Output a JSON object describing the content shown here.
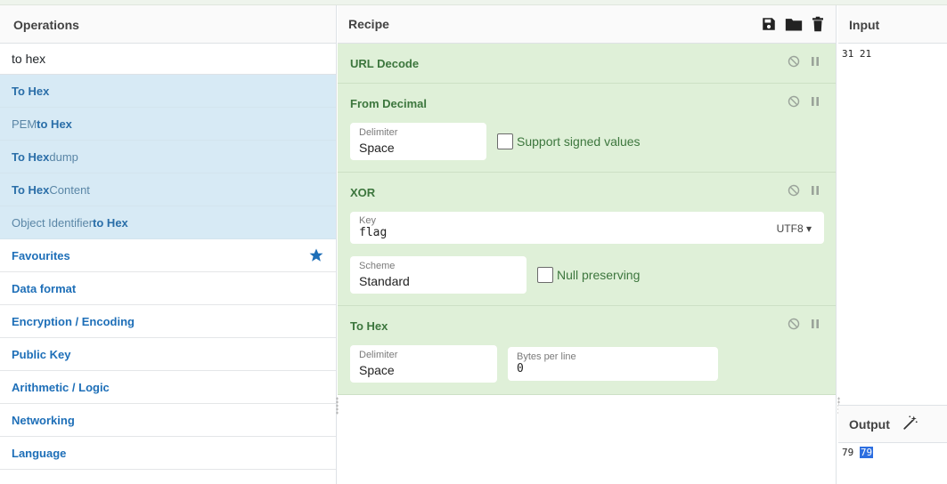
{
  "operations": {
    "title": "Operations",
    "search_value": "to hex",
    "results": [
      {
        "pre": "",
        "bold": "To Hex",
        "post": ""
      },
      {
        "pre": "PEM ",
        "bold": "to Hex",
        "post": ""
      },
      {
        "pre": "",
        "bold": "To Hex",
        "post": "dump"
      },
      {
        "pre": "",
        "bold": "To Hex",
        "post": " Content"
      },
      {
        "pre": "Object Identifier ",
        "bold": "to Hex",
        "post": ""
      }
    ],
    "categories": [
      "Favourites",
      "Data format",
      "Encryption / Encoding",
      "Public Key",
      "Arithmetic / Logic",
      "Networking",
      "Language"
    ],
    "favourite_icon": "star-icon",
    "accent_color": "#1e6fb8"
  },
  "recipe": {
    "title": "Recipe",
    "tool_icons": [
      "save-icon",
      "folder-icon",
      "trash-icon"
    ],
    "steps": {
      "url_decode": {
        "title": "URL Decode"
      },
      "from_decimal": {
        "title": "From Decimal",
        "delimiter_label": "Delimiter",
        "delimiter_value": "Space",
        "signed_label": "Support signed values"
      },
      "xor": {
        "title": "XOR",
        "key_label": "Key",
        "key_value": "flag",
        "key_encoding": "UTF8",
        "scheme_label": "Scheme",
        "scheme_value": "Standard",
        "null_label": "Null preserving"
      },
      "to_hex": {
        "title": "To Hex",
        "delimiter_label": "Delimiter",
        "delimiter_value": "Space",
        "bytes_label": "Bytes per line",
        "bytes_value": "0"
      }
    },
    "step_color": "#dff0d8"
  },
  "input": {
    "title": "Input",
    "text": "31 21"
  },
  "output": {
    "title": "Output",
    "text_plain": "79",
    "text_selected": "79",
    "magic_icon": "magic-wand-icon"
  }
}
